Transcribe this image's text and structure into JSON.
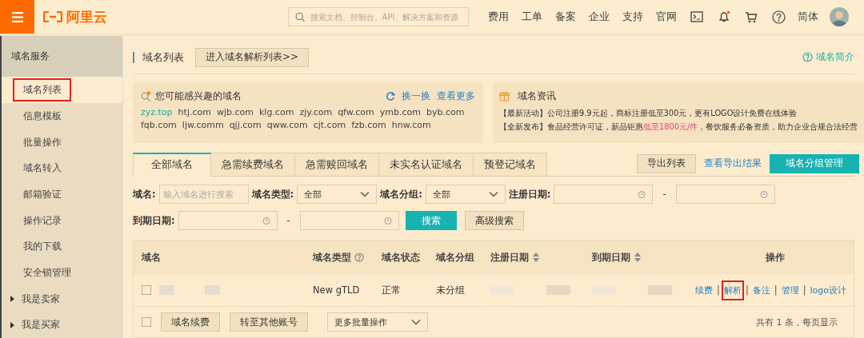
{
  "topbar": {
    "logo": "阿里云",
    "search_placeholder": "搜索文档、控制台、API、解决方案和资源",
    "nav": [
      "费用",
      "工单",
      "备案",
      "企业",
      "支持",
      "官网"
    ],
    "language": "简体"
  },
  "sidebar": {
    "title": "域名服务",
    "items": [
      {
        "label": "域名列表",
        "selected": true,
        "highlighted": true
      },
      {
        "label": "信息模板",
        "selected": false,
        "highlighted": false
      },
      {
        "label": "批量操作",
        "selected": false,
        "highlighted": false
      },
      {
        "label": "域名转入",
        "selected": false,
        "highlighted": false
      },
      {
        "label": "邮箱验证",
        "selected": false,
        "highlighted": false
      },
      {
        "label": "操作记录",
        "selected": false,
        "highlighted": false
      },
      {
        "label": "我的下载",
        "selected": false,
        "highlighted": false
      },
      {
        "label": "安全锁管理",
        "selected": false,
        "highlighted": false
      }
    ],
    "groups": [
      {
        "label": "我是卖家",
        "expanded": false
      },
      {
        "label": "我是买家",
        "expanded": false
      }
    ]
  },
  "header": {
    "title": "域名列表",
    "button": "进入域名解析列表>>",
    "help": "域名简介"
  },
  "suggestions": {
    "title": "您可能感兴趣的域名",
    "actions": [
      "换一换",
      "查看更多"
    ],
    "domains": [
      {
        "name": "zyz.top",
        "featured": true
      },
      {
        "name": "htj.com",
        "featured": false
      },
      {
        "name": "wjb.com",
        "featured": false
      },
      {
        "name": "klg.com",
        "featured": false
      },
      {
        "name": "zjy.com",
        "featured": false
      },
      {
        "name": "qfw.com",
        "featured": false
      },
      {
        "name": "ymb.com",
        "featured": false
      },
      {
        "name": "byb.com",
        "featured": false
      },
      {
        "name": "fqb.com",
        "featured": false
      },
      {
        "name": "ljw.comm",
        "featured": false
      },
      {
        "name": "qjj.com",
        "featured": false
      },
      {
        "name": "qww.com",
        "featured": false
      },
      {
        "name": "cjt.com",
        "featured": false
      },
      {
        "name": "fzb.com",
        "featured": false
      },
      {
        "name": "hnw.com",
        "featured": false
      }
    ]
  },
  "news": {
    "title": "域名资讯",
    "lines": [
      [
        {
          "text": "【最新活动】公司注册9.9元起，商标注册低至300元，更有LOGO设计免费在线体验",
          "kind": "normal"
        }
      ],
      [
        {
          "text": "【全新发布】食品经营许可证，新品钜惠",
          "kind": "normal"
        },
        {
          "text": "低至1800元/件",
          "kind": "highlight"
        },
        {
          "text": "，餐饮服务必备资质，助力企业合规合法经营",
          "kind": "normal"
        }
      ]
    ]
  },
  "tabs": [
    {
      "label": "全部域名",
      "selected": true
    },
    {
      "label": "急需续费域名",
      "selected": false
    },
    {
      "label": "急需赎回域名",
      "selected": false
    },
    {
      "label": "未实名认证域名",
      "selected": false
    },
    {
      "label": "预登记域名",
      "selected": false
    }
  ],
  "tab_actions": {
    "export": "导出列表",
    "export_results": "查看导出结果",
    "group_manage": "域名分组管理"
  },
  "filters": {
    "domain_label": "域名:",
    "domain_placeholder": "输入域名进行搜索",
    "type_label": "域名类型:",
    "type_value": "全部",
    "group_label": "域名分组:",
    "group_value": "全部",
    "reg_label": "注册日期:",
    "exp_label": "到期日期:",
    "range_sep": "-",
    "search": "搜索",
    "advanced": "高级搜索"
  },
  "table": {
    "columns": [
      {
        "label": "域名",
        "help": false,
        "sortable": false
      },
      {
        "label": "域名类型",
        "help": true,
        "sortable": false
      },
      {
        "label": "域名状态",
        "help": false,
        "sortable": false
      },
      {
        "label": "域名分组",
        "help": false,
        "sortable": false
      },
      {
        "label": "注册日期",
        "help": false,
        "sortable": true
      },
      {
        "label": "到期日期",
        "help": false,
        "sortable": true
      },
      {
        "label": "操作",
        "help": false,
        "sortable": false
      }
    ],
    "separator": "|",
    "rows": [
      {
        "checked": false,
        "type": "New gTLD",
        "status": "正常",
        "group": "未分组",
        "actions": [
          {
            "label": "续费",
            "highlighted": false
          },
          {
            "label": "解析",
            "highlighted": true
          },
          {
            "label": "备注",
            "highlighted": false
          },
          {
            "label": "管理",
            "highlighted": false
          },
          {
            "label": "logo设计",
            "highlighted": false
          }
        ]
      }
    ],
    "footer": {
      "checked": false,
      "buttons": [
        "域名续费",
        "转至其他账号"
      ],
      "batch_select": "更多批量操作",
      "pagination": "共有 1 条，每页显示"
    }
  }
}
